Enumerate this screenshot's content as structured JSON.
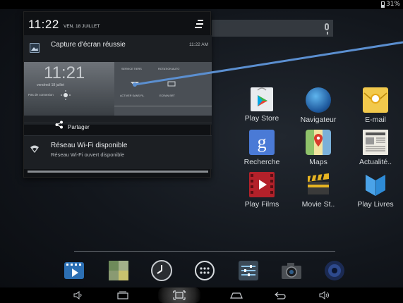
{
  "status_bar": {
    "battery": "31%"
  },
  "notification_panel": {
    "time": "11:22",
    "date": "VEN. 18 JUILLET",
    "notifications": [
      {
        "title": "Capture d'écran réussie",
        "time": "11:22 AM",
        "icon": "image-icon",
        "action": "Partager",
        "action_icon": "share-icon"
      },
      {
        "title": "Réseau Wi-Fi disponible",
        "subtitle": "Réseau Wi-Fi ouvert disponible",
        "icon": "wifi-icon"
      }
    ]
  },
  "screenshot_thumbnail": {
    "time": "11:21",
    "date": "vendredi 18 juillet",
    "weather": "Pas de connexion",
    "labels": [
      "SERVICE TIERS",
      "ROTATION AUTO",
      "ACTIVER SANS FIL",
      "ECRAN BRT"
    ]
  },
  "apps": [
    {
      "label": "Play Store",
      "icon": "play-store-icon"
    },
    {
      "label": "Navigateur",
      "icon": "globe-icon"
    },
    {
      "label": "E-mail",
      "icon": "email-icon"
    },
    {
      "label": "Recherche",
      "icon": "google-search-icon"
    },
    {
      "label": "Maps",
      "icon": "maps-icon"
    },
    {
      "label": "Actualité..",
      "icon": "news-icon"
    },
    {
      "label": "Play Films",
      "icon": "film-icon"
    },
    {
      "label": "Movie St..",
      "icon": "clapper-icon"
    },
    {
      "label": "Play Livres",
      "icon": "book-icon"
    }
  ],
  "dock": [
    {
      "icon": "video-player-icon"
    },
    {
      "icon": "gallery-icon"
    },
    {
      "icon": "clock-icon"
    },
    {
      "icon": "app-drawer-icon"
    },
    {
      "icon": "settings-icon"
    },
    {
      "icon": "camera-icon"
    },
    {
      "icon": "music-icon"
    }
  ],
  "nav": [
    {
      "icon": "volume-down-icon"
    },
    {
      "icon": "recent-apps-icon"
    },
    {
      "icon": "screenshot-icon"
    },
    {
      "icon": "home-icon"
    },
    {
      "icon": "back-icon"
    },
    {
      "icon": "volume-up-icon"
    }
  ]
}
